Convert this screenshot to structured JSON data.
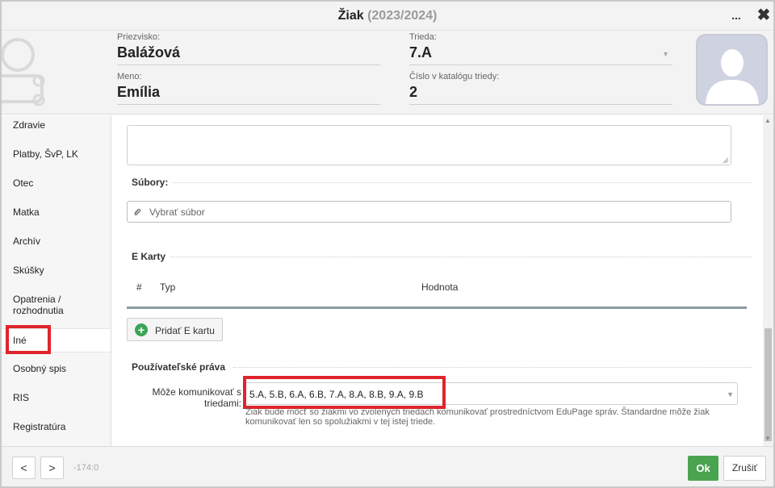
{
  "window": {
    "title": "Žiak",
    "year": "(2023/2024)",
    "more_label": "...",
    "close_label": "✖"
  },
  "header": {
    "surname": {
      "label": "Priezvisko:",
      "value": "Balážová"
    },
    "class": {
      "label": "Trieda:",
      "value": "7.A"
    },
    "first_name": {
      "label": "Meno:",
      "value": "Emília"
    },
    "catalog_number": {
      "label": "Číslo v katalógu triedy:",
      "value": "2"
    }
  },
  "sidebar": {
    "items": [
      {
        "label": "Zdravie"
      },
      {
        "label": "Platby, ŠvP, LK"
      },
      {
        "label": "Otec"
      },
      {
        "label": "Matka"
      },
      {
        "label": "Archív"
      },
      {
        "label": "Skúšky"
      },
      {
        "label": "Opatrenia / rozhodnutia"
      },
      {
        "label": "Iné"
      },
      {
        "label": "Osobný spis"
      },
      {
        "label": "RIS"
      },
      {
        "label": "Registratúra"
      }
    ],
    "active_index": 7
  },
  "main": {
    "files": {
      "title": "Súbory:",
      "placeholder": "Vybrať súbor"
    },
    "ecards": {
      "title": "E Karty",
      "columns": [
        "#",
        "Typ",
        "Hodnota"
      ],
      "add_button": "Pridať E kartu"
    },
    "permissions": {
      "title": "Používateľské práva",
      "field_label": "Môže komunikovať s triedami:",
      "value": "5.A, 5.B, 6.A, 6.B, 7.A, 8.A, 8.B, 9.A, 9.B",
      "help": "Žiak bude môcť so žiakmi vo zvolených triedach komunikovať prostredníctvom EduPage správ. Štandardne môže žiak komunikovať len so spolužiakmi v tej istej triede."
    }
  },
  "footer": {
    "prev_label": "<",
    "next_label": ">",
    "coords": "-174:0",
    "ok_label": "Ok",
    "cancel_label": "Zrušiť"
  },
  "colors": {
    "ok_green": "#4aa34f",
    "highlight_red": "#e0242c",
    "add_green": "#3aa655"
  },
  "icons": {
    "close": "close-icon",
    "more": "more-icon",
    "attach": "paperclip-icon",
    "add": "plus-circle-icon",
    "dropdown": "chevron-down-icon"
  }
}
